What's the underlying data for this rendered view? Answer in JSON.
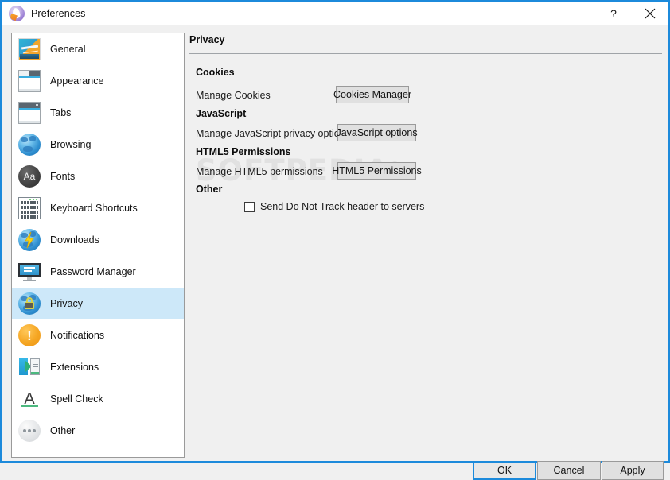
{
  "window": {
    "title": "Preferences",
    "icon": "otter-browser-icon",
    "accent_color": "#1c8adb",
    "background": "#f0f0f0",
    "help_label": "?",
    "close_label": "✕"
  },
  "sidebar": {
    "items": [
      {
        "label": "General",
        "icon": "picture-icon",
        "selected": false
      },
      {
        "label": "Appearance",
        "icon": "window-icon",
        "selected": false
      },
      {
        "label": "Tabs",
        "icon": "tabbed-window-icon",
        "selected": false
      },
      {
        "label": "Browsing",
        "icon": "globe-icon",
        "selected": false
      },
      {
        "label": "Fonts",
        "icon": "fonts-aa-icon",
        "selected": false
      },
      {
        "label": "Keyboard Shortcuts",
        "icon": "keyboard-icon",
        "selected": false
      },
      {
        "label": "Downloads",
        "icon": "globe-download-icon",
        "selected": false
      },
      {
        "label": "Password Manager",
        "icon": "monitor-icon",
        "selected": false
      },
      {
        "label": "Privacy",
        "icon": "globe-padlock-icon",
        "selected": true
      },
      {
        "label": "Notifications",
        "icon": "exclamation-icon",
        "selected": false
      },
      {
        "label": "Extensions",
        "icon": "extensions-icon",
        "selected": false
      },
      {
        "label": "Spell Check",
        "icon": "spell-check-a-icon",
        "selected": false
      },
      {
        "label": "Other",
        "icon": "ellipsis-icon",
        "selected": false
      }
    ],
    "selection_color": "#cde8f9"
  },
  "main": {
    "title": "Privacy",
    "groups": [
      {
        "title": "Cookies",
        "row_label": "Manage Cookies",
        "button_label": "Cookies Manager"
      },
      {
        "title": "JavaScript",
        "row_label": "Manage JavaScript privacy options",
        "button_label": "JavaScript options"
      },
      {
        "title": "HTML5 Permissions",
        "row_label": "Manage HTML5 permissions",
        "button_label": "HTML5 Permissions"
      }
    ],
    "other": {
      "title": "Other",
      "checkbox_label": "Send Do Not Track header to servers",
      "checkbox_checked": false
    }
  },
  "watermark": {
    "text": "SOFTPEDIA",
    "mark": "®"
  },
  "footer": {
    "ok_label": "OK",
    "cancel_label": "Cancel",
    "apply_label": "Apply",
    "default_button": "OK"
  }
}
